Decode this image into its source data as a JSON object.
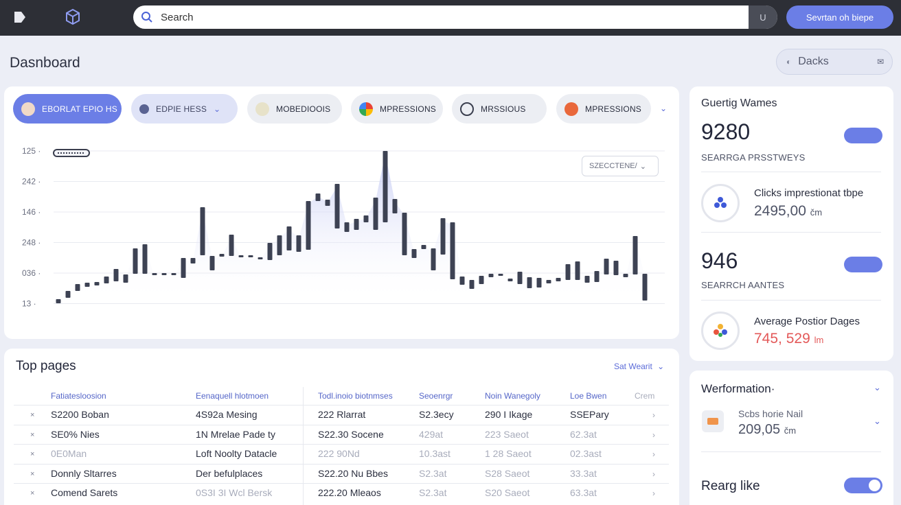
{
  "topbar": {
    "search_placeholder": "Search",
    "search_toggle": "U",
    "action_button": "Sevrtan oh biepe"
  },
  "page": {
    "title": "Dasnboard",
    "decks_button": "Dacks"
  },
  "filters": [
    {
      "label": "EBORLAT EPIO HS"
    },
    {
      "label": "EDPIE HESS"
    },
    {
      "label": "MOBEDIOOIS"
    },
    {
      "label": "MPRESSIONS"
    },
    {
      "label": "MRSSIOUS"
    },
    {
      "label": "MPRESSIONS"
    }
  ],
  "chart_data": {
    "type": "bar",
    "y_tick_labels": [
      "125",
      "242",
      "146",
      "248",
      "036",
      "13"
    ],
    "select_label": "SZECCTENE/",
    "grid": true
  },
  "stats": {
    "title": "Guertig Wames",
    "primary_value": "9280",
    "primary_label": "SEARRGA PRSSTWEYS",
    "clicks_label": "Clicks impresti­onat tbpe",
    "clicks_value": "2495,00",
    "clicks_unit": "čm",
    "secondary_value": "946",
    "secondary_label": "SEARRCH AANTES",
    "avg_label": "Average Postior Dages",
    "avg_value": "745, 529",
    "avg_unit": "lm"
  },
  "performance": {
    "title": "Werformation·",
    "item_label": "Scbs horie Nail",
    "item_value": "209,05",
    "item_unit": "čm",
    "footer_label": "Rearg like"
  },
  "table": {
    "title": "Top pages",
    "sort_label": "Sat Wearit",
    "headers": [
      "Fatiatesloosion",
      "Eenaquell hlotmoen",
      "Todl.inoio biotnmses",
      "Seoenrgr",
      "Noin Wanegoly",
      "Loe Bwen",
      "Crem"
    ],
    "rows": [
      {
        "c1": "S2200 Boban",
        "c2": "4S92a Mesing",
        "c3": "222 Rlarrat",
        "c4": "S2.3ecy",
        "c5": "290 I Ikage",
        "c6": "SSEPary",
        "dim": [
          false,
          false,
          false,
          false,
          false,
          false
        ]
      },
      {
        "c1": "SE0% Nies",
        "c2": "1N Mrelae Pade ty",
        "c3": "S22.30 Socene",
        "c4": "429at",
        "c5": "223 Saeot",
        "c6": "62.3at",
        "dim": [
          false,
          false,
          false,
          true,
          true,
          true
        ]
      },
      {
        "c1": "0E0Man",
        "c2": "Loft Noolty Datacle",
        "c3": "222 90Nd",
        "c4": "10.3ast",
        "c5": "1 28 Saeot",
        "c6": "02.3ast",
        "dim": [
          true,
          false,
          true,
          true,
          true,
          true
        ]
      },
      {
        "c1": "Donnly Sltarres",
        "c2": "Der befulplaces",
        "c3": "S22.20 Nu Bbes",
        "c4": "S2.3at",
        "c5": "S28 Saeot",
        "c6": "33.3at",
        "dim": [
          false,
          false,
          false,
          true,
          true,
          true
        ]
      },
      {
        "c1": "Comend Sarets",
        "c2": "0S3I 3I Wcl Bersk",
        "c3": "222.20 Mleaos",
        "c4": "S2.3at",
        "c5": "S20 Saeot",
        "c6": "63.3at",
        "dim": [
          false,
          true,
          false,
          true,
          true,
          true
        ]
      }
    ]
  }
}
